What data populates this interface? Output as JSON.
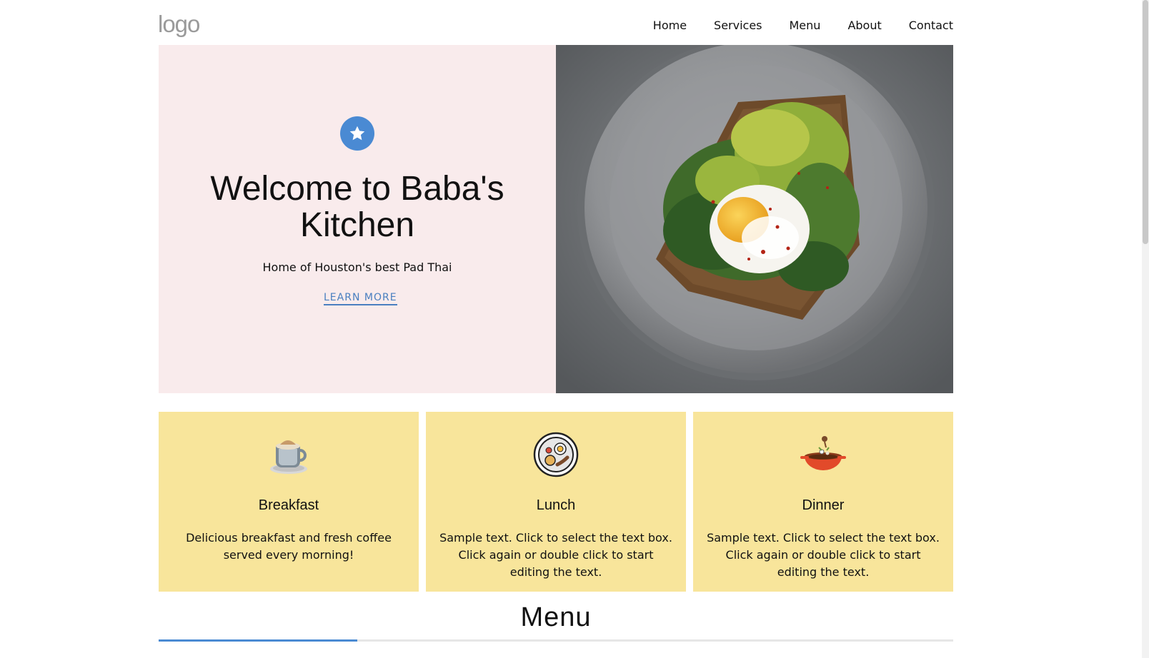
{
  "header": {
    "logo_text": "logo",
    "nav": [
      {
        "label": "Home"
      },
      {
        "label": "Services"
      },
      {
        "label": "Menu"
      },
      {
        "label": "About"
      },
      {
        "label": "Contact"
      }
    ]
  },
  "hero": {
    "badge_icon": "star-icon",
    "title": "Welcome to Baba's Kitchen",
    "subtitle": "Home of Houston's best Pad Thai",
    "cta_label": "LEARN MORE",
    "image_icon": "avocado-toast-photo"
  },
  "cards": [
    {
      "icon": "coffee-cup-icon",
      "title": "Breakfast",
      "text": "Delicious breakfast and fresh coffee served every morning!"
    },
    {
      "icon": "plate-icon",
      "title": "Lunch",
      "text": "Sample text. Click to select the text box. Click again or double click to start editing the text."
    },
    {
      "icon": "dinner-bowl-icon",
      "title": "Dinner",
      "text": "Sample text. Click to select the text box. Click again or double click to start editing the text."
    }
  ],
  "menu": {
    "heading": "Menu"
  },
  "colors": {
    "accent": "#4a8ad3",
    "hero_bg": "#f9ebec",
    "card_bg": "#f8e59b"
  }
}
